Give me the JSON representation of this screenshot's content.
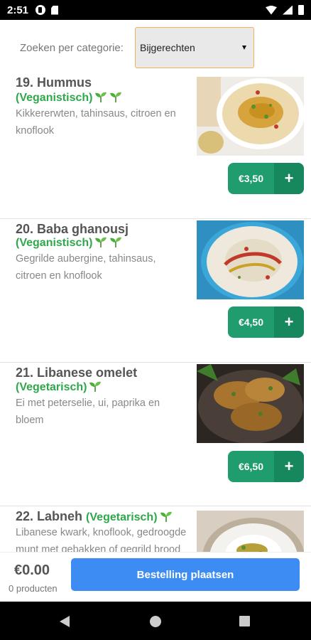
{
  "status": {
    "time": "2:51"
  },
  "filter": {
    "label": "Zoeken per categorie:",
    "selected": "Bijgerechten"
  },
  "items": [
    {
      "title": "19. Hummus",
      "diet": "(Veganistisch)",
      "description": "Kikkererwten, tahinsaus, citroen en knoflook",
      "price": "€3,50"
    },
    {
      "title": "20. Baba ghanousj",
      "diet": "(Veganistisch)",
      "description": "Gegrilde aubergine, tahinsaus, citroen en knoflook",
      "price": "€4,50"
    },
    {
      "title": "21. Libanese omelet",
      "diet": "(Vegetarisch)",
      "description": "Ei met peterselie, ui, paprika en bloem",
      "price": "€6,50"
    },
    {
      "title": "22. Labneh",
      "diet": "(Vegetarisch)",
      "description": "Libanese kwark, knoflook, gedroogde munt met gebakken of gegrild brood"
    }
  ],
  "cart": {
    "total": "€0.00",
    "count": "0 producten",
    "order_label": "Bestelling plaatsen"
  },
  "colors": {
    "accent_green": "#1f9d6e",
    "diet_green": "#2ea84a",
    "order_blue": "#3d8cf4",
    "select_border": "#f0b060"
  }
}
